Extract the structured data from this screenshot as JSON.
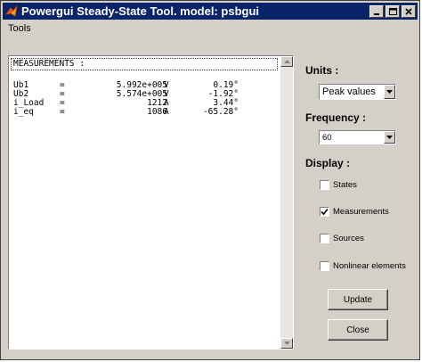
{
  "window": {
    "title": "Powergui Steady-State Tool. model: psbgui",
    "minimize_icon": "minimize-icon",
    "maximize_icon": "maximize-icon",
    "close_icon": "close-icon"
  },
  "menu": {
    "items": [
      {
        "label": "Tools"
      }
    ]
  },
  "measurements": {
    "header": "MEASUREMENTS :",
    "rows": [
      {
        "name": "Ub1",
        "eq": "=",
        "value": "5.992e+005",
        "unit": "V",
        "angle": "0.19°"
      },
      {
        "name": "Ub2",
        "eq": "=",
        "value": "5.574e+005",
        "unit": "V",
        "angle": "-1.92°"
      },
      {
        "name": "i_Load",
        "eq": "=",
        "value": "1212",
        "unit": "A",
        "angle": "3.44°"
      },
      {
        "name": "i_eq",
        "eq": "=",
        "value": "1086",
        "unit": "A",
        "angle": "-65.28°"
      }
    ]
  },
  "units": {
    "label": "Units :",
    "selected": "Peak values"
  },
  "frequency": {
    "label": "Frequency :",
    "selected": "60"
  },
  "display": {
    "label": "Display :",
    "options": [
      {
        "label": "States",
        "checked": false
      },
      {
        "label": "Measurements",
        "checked": true
      },
      {
        "label": "Sources",
        "checked": false
      },
      {
        "label": "Nonlinear elements",
        "checked": false
      }
    ]
  },
  "buttons": {
    "update": "Update",
    "close": "Close"
  }
}
